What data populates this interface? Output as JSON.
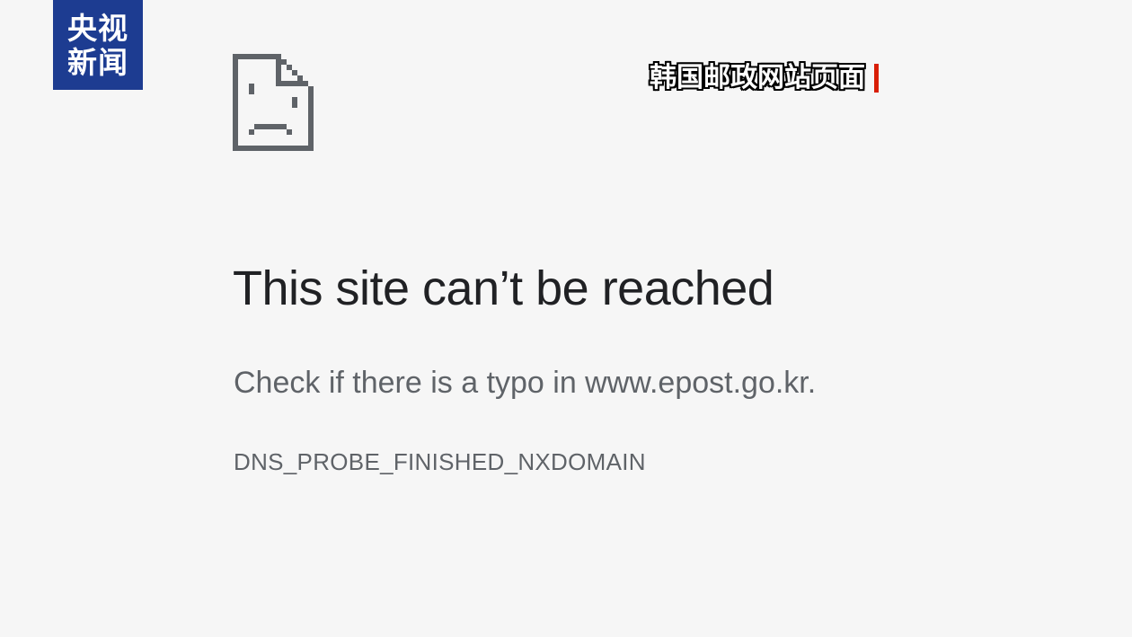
{
  "logo": {
    "line1": "央视",
    "line2": "新闻",
    "background": "#1d3c91"
  },
  "caption": {
    "text": "韩国邮政网站页面",
    "accent_color": "#d81e06"
  },
  "error_page": {
    "icon": "sad-document-icon",
    "title": "This site can’t be reached",
    "message": "Check if there is a typo in www.epost.go.kr.",
    "error_code": "DNS_PROBE_FINISHED_NXDOMAIN"
  },
  "colors": {
    "background": "#f6f6f6",
    "title": "#202124",
    "secondary_text": "#5f6368",
    "icon": "#5f6368"
  }
}
